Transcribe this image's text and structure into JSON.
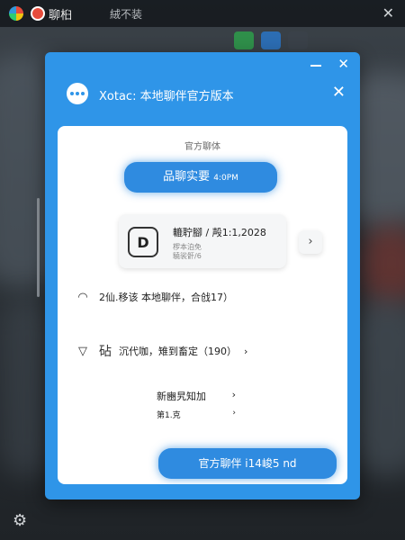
{
  "topbar": {
    "app_name": "聊桕",
    "status": "絨不装",
    "close_glyph": "✕"
  },
  "dialog": {
    "title": "Xotac: 本地聊伴官方版本",
    "card_caption": "官方聊体",
    "highlight_label": "品聊实要",
    "highlight_time": "4:0PM",
    "account": {
      "badge": "D",
      "name": "轆聍腳 / 殸1:1,2028",
      "sub_line1": "椤本泊免",
      "sub_line2": "驍裟骭/6"
    },
    "row1": {
      "icon": "wifi-icon",
      "text": "2仙.移该  本地聊伴，合戗17）"
    },
    "row2": {
      "icon_label": "砧",
      "text": "沉代咖，雉到畜定（190）"
    },
    "link1": "新豳旯知加",
    "link2": "第1.克",
    "primary_label": "官方聊伴 i14峻5 nd"
  }
}
